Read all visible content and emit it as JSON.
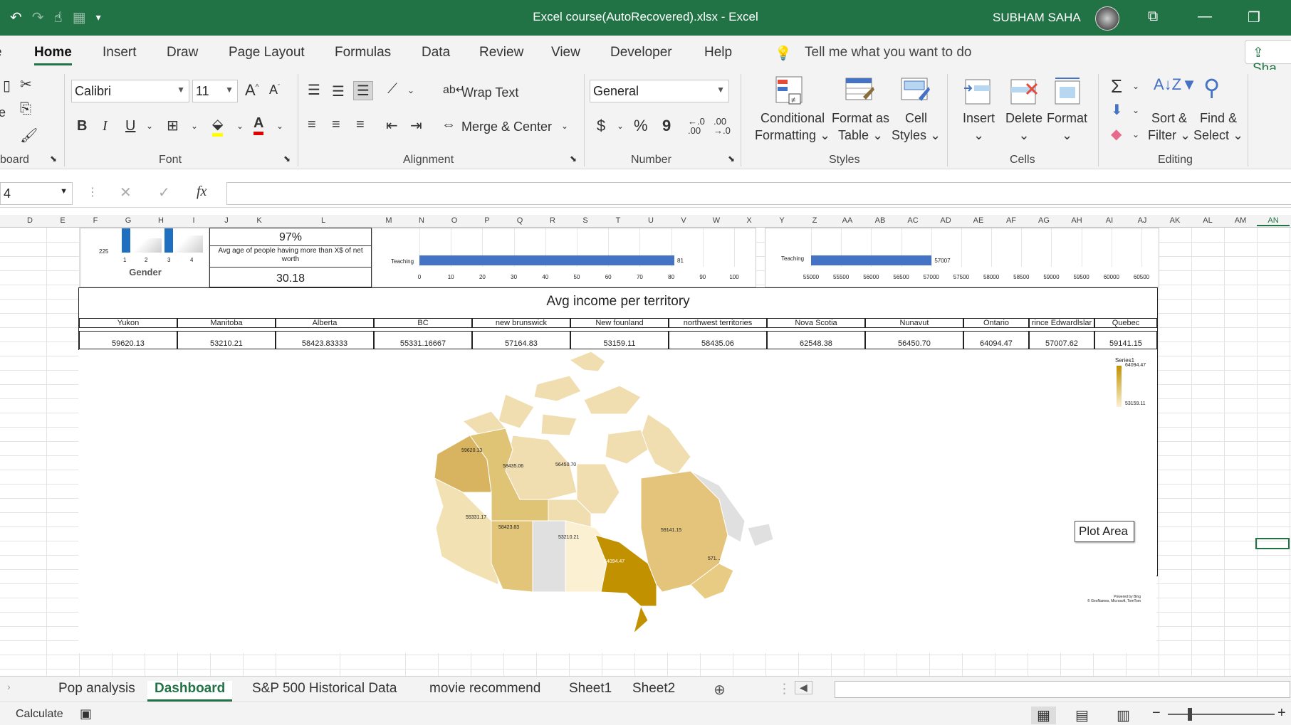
{
  "title_bar": {
    "document_title": "Excel course(AutoRecovered).xlsx  -  Excel",
    "user_name": "SUBHAM SAHA"
  },
  "ribbon_tabs": [
    "Home",
    "Insert",
    "Draw",
    "Page Layout",
    "Formulas",
    "Data",
    "Review",
    "View",
    "Developer",
    "Help"
  ],
  "active_tab": "Home",
  "tell_me": "Tell me what you want to do",
  "share_label": "Sha",
  "font": {
    "name": "Calibri",
    "size": "11",
    "group_label": "Font"
  },
  "clipboard": {
    "group_label": "board"
  },
  "alignment": {
    "wrap_text": "Wrap Text",
    "merge_center": "Merge & Center",
    "group_label": "Alignment"
  },
  "number": {
    "format": "General",
    "group_label": "Number",
    "currency": "$",
    "percent": "%",
    "comma": "9"
  },
  "styles": {
    "conditional": [
      "Conditional",
      "Formatting"
    ],
    "format_table": [
      "Format as",
      "Table"
    ],
    "cell_styles": [
      "Cell",
      "Styles"
    ],
    "group_label": "Styles"
  },
  "cells": {
    "insert": "Insert",
    "delete": "Delete",
    "format": "Format",
    "group_label": "Cells"
  },
  "editing": {
    "sort": [
      "Sort &",
      "Filter"
    ],
    "find": [
      "Find &",
      "Select"
    ],
    "group_label": "Editing"
  },
  "formula_bar": {
    "name_box": "4",
    "fx": "fx",
    "value": ""
  },
  "columns": [
    "D",
    "E",
    "F",
    "G",
    "H",
    "I",
    "J",
    "K",
    "L",
    "M",
    "N",
    "O",
    "P",
    "Q",
    "R",
    "S",
    "T",
    "U",
    "V",
    "W",
    "X",
    "Y",
    "Z",
    "AA",
    "AB",
    "AC",
    "AD",
    "AE",
    "AF",
    "AG",
    "AH",
    "AI",
    "AJ",
    "AK",
    "AL",
    "AM",
    "AN"
  ],
  "gender_chart": {
    "title": "Gender",
    "y_tick": "225",
    "x_ticks": [
      "1",
      "2",
      "3",
      "4"
    ]
  },
  "kpi": {
    "percent": "97%",
    "caption": "Avg age of people having more than X$ of net worth",
    "value": "30.18"
  },
  "teaching_chart_1": {
    "category": "Teaching",
    "value": "81",
    "ticks": [
      "0",
      "10",
      "20",
      "30",
      "40",
      "50",
      "60",
      "70",
      "80",
      "90",
      "100"
    ]
  },
  "teaching_chart_2": {
    "category": "Teaching",
    "value": "57007",
    "ticks": [
      "55000",
      "55500",
      "56000",
      "56500",
      "57000",
      "57500",
      "58000",
      "58500",
      "59000",
      "59500",
      "60000",
      "60500"
    ]
  },
  "income_table": {
    "title": "Avg income per territory",
    "headers": [
      "Yukon",
      "Manitoba",
      "Alberta",
      "BC",
      "new brunswick",
      "New founland",
      "northwest territories",
      "Nova Scotia",
      "Nunavut",
      "Ontario",
      "rince Edwardlslar",
      "Quebec"
    ],
    "values": [
      "59620.13",
      "53210.21",
      "58423.83333",
      "55331.16667",
      "57164.83",
      "53159.11",
      "58435.06",
      "62548.38",
      "56450.70",
      "64094.47",
      "57007.62",
      "59141.15"
    ]
  },
  "map": {
    "legend_series": "Series1",
    "legend_max": "64094.47",
    "legend_min": "53159.11",
    "labels": {
      "yukon": "59620.13",
      "nwt": "58435.06",
      "nunavut": "56450.70",
      "bc": "55331.17",
      "alberta": "58423.83",
      "manitoba": "53210.21",
      "ontario": "64094.47",
      "quebec": "59141.15",
      "maritimes": "571..."
    },
    "attribution": [
      "Powered by Bing",
      "© GeoNames, Microsoft, TomTom"
    ],
    "plot_area_label": "Plot Area"
  },
  "sheet_tabs": [
    "Pop analysis",
    "Dashboard",
    "S&P 500 Historical Data",
    "movie recommend",
    "Sheet1",
    "Sheet2"
  ],
  "active_sheet": "Dashboard",
  "status": "Calculate",
  "colors": {
    "excel_green": "#217346",
    "bar_blue": "#4472c4",
    "gold_dark": "#c29100",
    "gold_light": "#f6e8c1"
  }
}
